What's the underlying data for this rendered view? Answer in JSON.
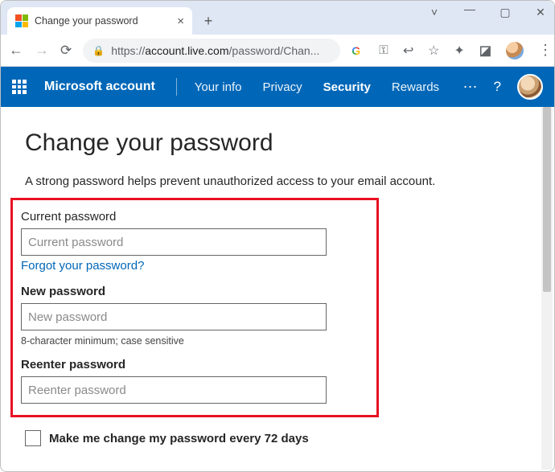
{
  "browser": {
    "tab_title": "Change your password",
    "url_scheme": "https://",
    "url_host": "account.live.com",
    "url_path": "/password/Chan..."
  },
  "msnav": {
    "brand": "Microsoft account",
    "links": {
      "your_info": "Your info",
      "privacy": "Privacy",
      "security": "Security",
      "rewards": "Rewards"
    },
    "more": "⋯",
    "help": "?"
  },
  "page": {
    "heading": "Change your password",
    "description": "A strong password helps prevent unauthorized access to your email account.",
    "current_label": "Current password",
    "current_placeholder": "Current password",
    "forgot_link": "Forgot your password?",
    "new_label": "New password",
    "new_placeholder": "New password",
    "new_hint": "8-character minimum; case sensitive",
    "reenter_label": "Reenter password",
    "reenter_placeholder": "Reenter password",
    "checkbox_label": "Make me change my password every 72 days"
  }
}
